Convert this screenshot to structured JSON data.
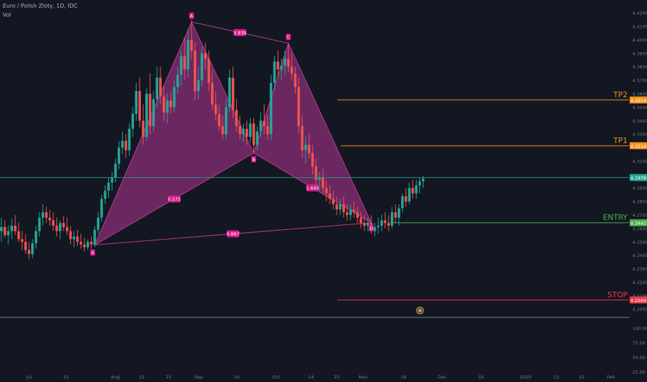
{
  "header": {
    "symbol_line": "Euro / Polish Zloty, 1D, IDC",
    "volume_label": "Vol"
  },
  "colors": {
    "bg": "#131722",
    "up": "#26a69a",
    "down": "#ef5350",
    "pattern_fill": "#7b2a6b",
    "pattern_line": "#c0398f",
    "tp": "#f7931a",
    "entry": "#4caf50",
    "stop": "#f23645",
    "price_line": "#2f8f88",
    "axis_text": "#787b86"
  },
  "price_axis": {
    "ticks": [
      "4.4200",
      "4.4100",
      "4.4000",
      "4.3900",
      "4.3800",
      "4.3700",
      "4.3600",
      "4.3500",
      "4.3400",
      "4.3300",
      "4.3200",
      "4.3100",
      "4.3000",
      "4.2900",
      "4.2800",
      "4.2700",
      "4.2600",
      "4.2500",
      "4.2400",
      "4.2300",
      "4.2200",
      "4.2100",
      "4.2000"
    ]
  },
  "volume_axis": {
    "ticks": [
      "100.00",
      "75.00",
      "50.00",
      "25.00"
    ]
  },
  "time_axis": {
    "labels": [
      "Jul",
      "15",
      "Aug",
      "12",
      "21",
      "Sep",
      "16",
      "Oct",
      "14",
      "23",
      "Nov",
      "18",
      "Dec",
      "16",
      "2020",
      "13",
      "22",
      "Feb"
    ]
  },
  "levels": [
    {
      "name": "TP2",
      "price": 4.3554,
      "label": "4.3554",
      "color": "#f7931a"
    },
    {
      "name": "TP1",
      "price": 4.3214,
      "label": "4.3214",
      "color": "#f7931a"
    },
    {
      "name": "ENTRY",
      "price": 4.2642,
      "label": "4.2642",
      "color": "#4caf50"
    },
    {
      "name": "STOP",
      "price": 4.2069,
      "label": "4.2069",
      "color": "#f23645"
    }
  ],
  "current_price": {
    "value": 4.2978,
    "label": "4.2978"
  },
  "pattern": {
    "points": [
      {
        "name": "X",
        "date_index": 27,
        "price": 4.2478
      },
      {
        "name": "A",
        "date_index": 55,
        "price": 4.4133
      },
      {
        "name": "B",
        "date_index": 73,
        "price": 4.316
      },
      {
        "name": "C",
        "date_index": 83,
        "price": 4.3976
      },
      {
        "name": "D",
        "date_index": 107,
        "price": 4.2642
      }
    ],
    "ratios": [
      {
        "label": "0.838",
        "between": "A-C"
      },
      {
        "label": "0.575",
        "between": "X-B"
      },
      {
        "label": "1.645",
        "between": "B-D"
      },
      {
        "label": "0.887",
        "between": "X-D"
      }
    ]
  },
  "chart_data": {
    "type": "candlestick",
    "title": "Euro / Polish Zloty, 1D, IDC",
    "candles": [
      [
        4.258,
        4.268,
        4.25,
        4.261
      ],
      [
        4.261,
        4.266,
        4.253,
        4.255
      ],
      [
        4.255,
        4.262,
        4.248,
        4.258
      ],
      [
        4.258,
        4.267,
        4.252,
        4.262
      ],
      [
        4.262,
        4.27,
        4.255,
        4.258
      ],
      [
        4.258,
        4.264,
        4.25,
        4.252
      ],
      [
        4.252,
        4.258,
        4.244,
        4.25
      ],
      [
        4.25,
        4.256,
        4.241,
        4.244
      ],
      [
        4.244,
        4.25,
        4.237,
        4.241
      ],
      [
        4.241,
        4.252,
        4.238,
        4.249
      ],
      [
        4.249,
        4.262,
        4.245,
        4.258
      ],
      [
        4.258,
        4.272,
        4.254,
        4.268
      ],
      [
        4.268,
        4.278,
        4.262,
        4.272
      ],
      [
        4.272,
        4.276,
        4.264,
        4.268
      ],
      [
        4.268,
        4.274,
        4.262,
        4.266
      ],
      [
        4.266,
        4.272,
        4.258,
        4.262
      ],
      [
        4.262,
        4.268,
        4.254,
        4.258
      ],
      [
        4.258,
        4.266,
        4.252,
        4.264
      ],
      [
        4.264,
        4.269,
        4.258,
        4.261
      ],
      [
        4.261,
        4.268,
        4.255,
        4.258
      ],
      [
        4.258,
        4.262,
        4.248,
        4.252
      ],
      [
        4.252,
        4.258,
        4.246,
        4.254
      ],
      [
        4.254,
        4.259,
        4.247,
        4.25
      ],
      [
        4.25,
        4.256,
        4.245,
        4.248
      ],
      [
        4.248,
        4.253,
        4.243,
        4.246
      ],
      [
        4.246,
        4.252,
        4.244,
        4.25
      ],
      [
        4.25,
        4.254,
        4.245,
        4.248
      ],
      [
        4.248,
        4.262,
        4.246,
        4.259
      ],
      [
        4.259,
        4.272,
        4.256,
        4.268
      ],
      [
        4.268,
        4.285,
        4.265,
        4.282
      ],
      [
        4.282,
        4.292,
        4.278,
        4.288
      ],
      [
        4.288,
        4.298,
        4.283,
        4.294
      ],
      [
        4.294,
        4.302,
        4.288,
        4.298
      ],
      [
        4.298,
        4.312,
        4.294,
        4.308
      ],
      [
        4.308,
        4.325,
        4.304,
        4.32
      ],
      [
        4.32,
        4.332,
        4.315,
        4.325
      ],
      [
        4.325,
        4.33,
        4.312,
        4.318
      ],
      [
        4.318,
        4.338,
        4.314,
        4.334
      ],
      [
        4.334,
        4.35,
        4.328,
        4.345
      ],
      [
        4.345,
        4.368,
        4.34,
        4.362
      ],
      [
        4.362,
        4.372,
        4.335,
        4.34
      ],
      [
        4.34,
        4.352,
        4.322,
        4.328
      ],
      [
        4.328,
        4.364,
        4.325,
        4.36
      ],
      [
        4.36,
        4.375,
        4.33,
        4.336
      ],
      [
        4.336,
        4.362,
        4.332,
        4.356
      ],
      [
        4.356,
        4.38,
        4.35,
        4.372
      ],
      [
        4.372,
        4.38,
        4.352,
        4.358
      ],
      [
        4.358,
        4.366,
        4.34,
        4.346
      ],
      [
        4.346,
        4.36,
        4.338,
        4.355
      ],
      [
        4.355,
        4.362,
        4.345,
        4.35
      ],
      [
        4.35,
        4.37,
        4.346,
        4.365
      ],
      [
        4.365,
        4.38,
        4.36,
        4.374
      ],
      [
        4.374,
        4.392,
        4.366,
        4.388
      ],
      [
        4.388,
        4.402,
        4.37,
        4.378
      ],
      [
        4.378,
        4.408,
        4.372,
        4.4
      ],
      [
        4.4,
        4.415,
        4.385,
        4.392
      ],
      [
        4.392,
        4.398,
        4.355,
        4.362
      ],
      [
        4.362,
        4.38,
        4.356,
        4.37
      ],
      [
        4.37,
        4.395,
        4.366,
        4.39
      ],
      [
        4.39,
        4.398,
        4.378,
        4.386
      ],
      [
        4.386,
        4.392,
        4.362,
        4.368
      ],
      [
        4.368,
        4.378,
        4.348,
        4.352
      ],
      [
        4.352,
        4.362,
        4.34,
        4.345
      ],
      [
        4.345,
        4.352,
        4.332,
        4.336
      ],
      [
        4.336,
        4.344,
        4.326,
        4.33
      ],
      [
        4.33,
        4.356,
        4.326,
        4.35
      ],
      [
        4.35,
        4.378,
        4.346,
        4.372
      ],
      [
        4.372,
        4.38,
        4.342,
        4.348
      ],
      [
        4.348,
        4.356,
        4.332,
        4.336
      ],
      [
        4.336,
        4.344,
        4.326,
        4.33
      ],
      [
        4.33,
        4.338,
        4.324,
        4.334
      ],
      [
        4.334,
        4.34,
        4.322,
        4.328
      ],
      [
        4.328,
        4.342,
        4.324,
        4.338
      ],
      [
        4.338,
        4.342,
        4.316,
        4.322
      ],
      [
        4.322,
        4.336,
        4.318,
        4.332
      ],
      [
        4.332,
        4.346,
        4.328,
        4.34
      ],
      [
        4.34,
        4.352,
        4.33,
        4.336
      ],
      [
        4.336,
        4.344,
        4.326,
        4.33
      ],
      [
        4.33,
        4.374,
        4.326,
        4.368
      ],
      [
        4.368,
        4.388,
        4.362,
        4.384
      ],
      [
        4.384,
        4.392,
        4.372,
        4.378
      ],
      [
        4.378,
        4.386,
        4.37,
        4.381
      ],
      [
        4.381,
        4.392,
        4.374,
        4.386
      ],
      [
        4.386,
        4.398,
        4.376,
        4.38
      ],
      [
        4.38,
        4.39,
        4.37,
        4.375
      ],
      [
        4.375,
        4.38,
        4.36,
        4.365
      ],
      [
        4.365,
        4.372,
        4.33,
        4.336
      ],
      [
        4.336,
        4.344,
        4.312,
        4.318
      ],
      [
        4.318,
        4.328,
        4.308,
        4.322
      ],
      [
        4.322,
        4.33,
        4.312,
        4.316
      ],
      [
        4.316,
        4.322,
        4.3,
        4.306
      ],
      [
        4.306,
        4.312,
        4.292,
        4.296
      ],
      [
        4.296,
        4.302,
        4.288,
        4.298
      ],
      [
        4.298,
        4.304,
        4.286,
        4.29
      ],
      [
        4.29,
        4.296,
        4.28,
        4.286
      ],
      [
        4.286,
        4.292,
        4.278,
        4.282
      ],
      [
        4.282,
        4.288,
        4.274,
        4.278
      ],
      [
        4.278,
        4.284,
        4.27,
        4.274
      ],
      [
        4.274,
        4.282,
        4.27,
        4.278
      ],
      [
        4.278,
        4.284,
        4.268,
        4.272
      ],
      [
        4.272,
        4.278,
        4.266,
        4.27
      ],
      [
        4.27,
        4.278,
        4.266,
        4.274
      ],
      [
        4.274,
        4.28,
        4.268,
        4.272
      ],
      [
        4.272,
        4.276,
        4.264,
        4.268
      ],
      [
        4.268,
        4.272,
        4.26,
        4.264
      ],
      [
        4.264,
        4.27,
        4.258,
        4.262
      ],
      [
        4.262,
        4.268,
        4.258,
        4.264
      ],
      [
        4.264,
        4.27,
        4.256,
        4.258
      ],
      [
        4.258,
        4.264,
        4.254,
        4.261
      ],
      [
        4.261,
        4.268,
        4.256,
        4.262
      ],
      [
        4.262,
        4.27,
        4.258,
        4.266
      ],
      [
        4.266,
        4.272,
        4.26,
        4.264
      ],
      [
        4.264,
        4.27,
        4.258,
        4.262
      ],
      [
        4.262,
        4.276,
        4.26,
        4.272
      ],
      [
        4.272,
        4.278,
        4.264,
        4.268
      ],
      [
        4.268,
        4.278,
        4.262,
        4.275
      ],
      [
        4.275,
        4.286,
        4.272,
        4.284
      ],
      [
        4.284,
        4.29,
        4.276,
        4.28
      ],
      [
        4.28,
        4.294,
        4.278,
        4.29
      ],
      [
        4.29,
        4.296,
        4.282,
        4.286
      ],
      [
        4.286,
        4.296,
        4.282,
        4.292
      ],
      [
        4.292,
        4.298,
        4.286,
        4.295
      ],
      [
        4.295,
        4.299,
        4.29,
        4.297
      ]
    ],
    "price_range": [
      4.1965,
      4.4255
    ],
    "x_axis": "Jul 2019 – Feb 2020",
    "y_axis_scale": "price",
    "grid": false
  }
}
